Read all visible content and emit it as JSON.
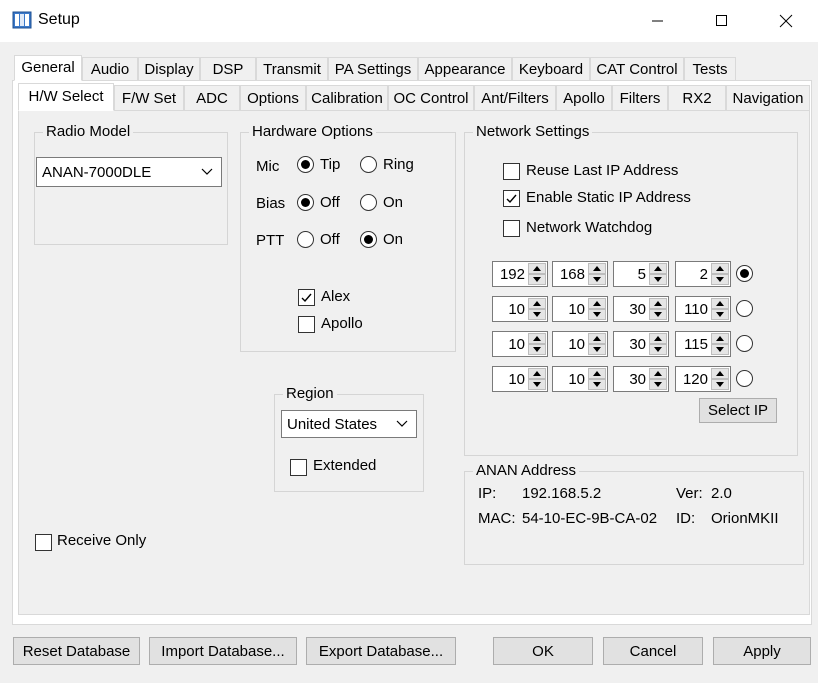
{
  "window": {
    "title": "Setup",
    "controls": {
      "minimize": "minimize-icon",
      "maximize": "maximize-icon",
      "close": "close-icon"
    }
  },
  "tabs": [
    "General",
    "Audio",
    "Display",
    "DSP",
    "Transmit",
    "PA Settings",
    "Appearance",
    "Keyboard",
    "CAT Control",
    "Tests"
  ],
  "subtabs": [
    "H/W Select",
    "F/W Set",
    "ADC",
    "Options",
    "Calibration",
    "OC Control",
    "Ant/Filters",
    "Apollo",
    "Filters",
    "RX2",
    "Navigation"
  ],
  "radio_model": {
    "label": "Radio Model",
    "value": "ANAN-7000DLE"
  },
  "hardware_options": {
    "label": "Hardware Options",
    "mic": {
      "label": "Mic",
      "opt1": "Tip",
      "opt2": "Ring"
    },
    "bias": {
      "label": "Bias",
      "opt1": "Off",
      "opt2": "On"
    },
    "ptt": {
      "label": "PTT",
      "opt1": "Off",
      "opt2": "On"
    },
    "alex": "Alex",
    "apollo": "Apollo"
  },
  "region": {
    "label": "Region",
    "value": "United States",
    "extended": "Extended"
  },
  "network": {
    "label": "Network Settings",
    "reuse_last_ip": "Reuse Last IP Address",
    "enable_static_ip": "Enable Static IP Address",
    "network_watchdog": "Network Watchdog",
    "ip_rows": [
      [
        "192",
        "168",
        "5",
        "2"
      ],
      [
        "10",
        "10",
        "30",
        "110"
      ],
      [
        "10",
        "10",
        "30",
        "115"
      ],
      [
        "10",
        "10",
        "30",
        "120"
      ]
    ],
    "select_ip": "Select IP"
  },
  "anan_address": {
    "label": "ANAN Address",
    "ip_label": "IP:",
    "ip_value": "192.168.5.2",
    "ver_label": "Ver:",
    "ver_value": "2.0",
    "mac_label": "MAC:",
    "mac_value": "54-10-EC-9B-CA-02",
    "id_label": "ID:",
    "id_value": "OrionMKII"
  },
  "receive_only": "Receive Only",
  "buttons": {
    "reset_db": "Reset Database",
    "import_db": "Import Database...",
    "export_db": "Export Database...",
    "ok": "OK",
    "cancel": "Cancel",
    "apply": "Apply"
  }
}
